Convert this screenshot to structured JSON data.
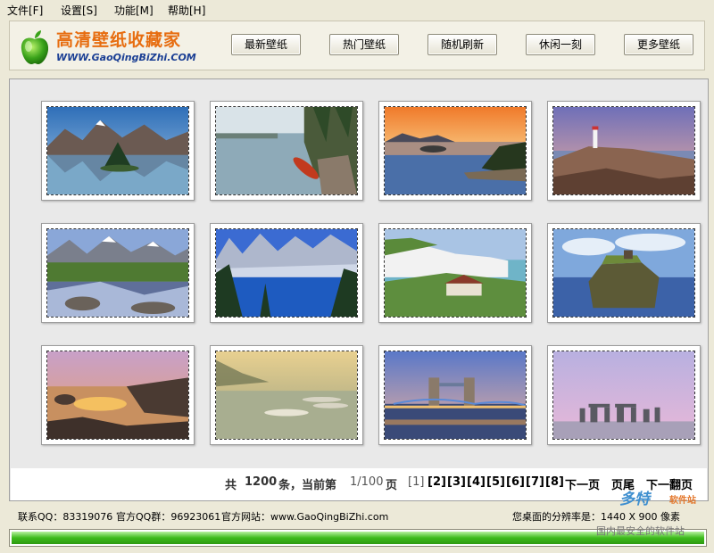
{
  "menu": [
    {
      "label": "文件[F]"
    },
    {
      "label": "设置[S]"
    },
    {
      "label": "功能[M]"
    },
    {
      "label": "帮助[H]"
    }
  ],
  "header": {
    "title": "高清壁纸收藏家",
    "url": "WWW.GaoQingBiZhi.COM",
    "buttons": [
      "最新壁纸",
      "热门壁纸",
      "随机刷新",
      "休闲一刻",
      "更多壁纸"
    ]
  },
  "gallery": {
    "thumbnails": [
      {
        "scene": "mountain-lake-reflection"
      },
      {
        "scene": "canoe-on-misty-lake"
      },
      {
        "scene": "sunset-lake-islands"
      },
      {
        "scene": "lighthouse-coast"
      },
      {
        "scene": "mountain-river-stream"
      },
      {
        "scene": "glacier-blue-lake"
      },
      {
        "scene": "white-cliffs-coast"
      },
      {
        "scene": "sea-stack-castle"
      },
      {
        "scene": "rocky-shore-sunset"
      },
      {
        "scene": "misty-lake-boats"
      },
      {
        "scene": "tower-bridge-night"
      },
      {
        "scene": "stonehenge-twilight"
      }
    ]
  },
  "pager": {
    "total_prefix": "共",
    "total": "1200",
    "total_unit": "条，当前第",
    "current": "1/100",
    "current_unit": "页",
    "pages": [
      "[1]",
      "[2]",
      "[3]",
      "[4]",
      "[5]",
      "[6]",
      "[7]",
      "[8]"
    ],
    "next": "下一页",
    "last": "页尾",
    "next_set": "下一翻页"
  },
  "status": {
    "qq": "联系QQ：83319076",
    "qq_group": "官方QQ群：96923061",
    "site": "官方网站：www.GaoQingBiZhi.com",
    "resolution": "您桌面的分辨率是：1440 X 900 像素"
  },
  "progress": {
    "fraction": 1.0
  },
  "watermark": {
    "brand": "多特",
    "brand_sub": "软件站",
    "tagline": "国内最安全的软件站"
  },
  "colors": {
    "title_orange": "#e76d10",
    "url_blue": "#1b3f94",
    "progress_green": "#3dbb1c"
  }
}
